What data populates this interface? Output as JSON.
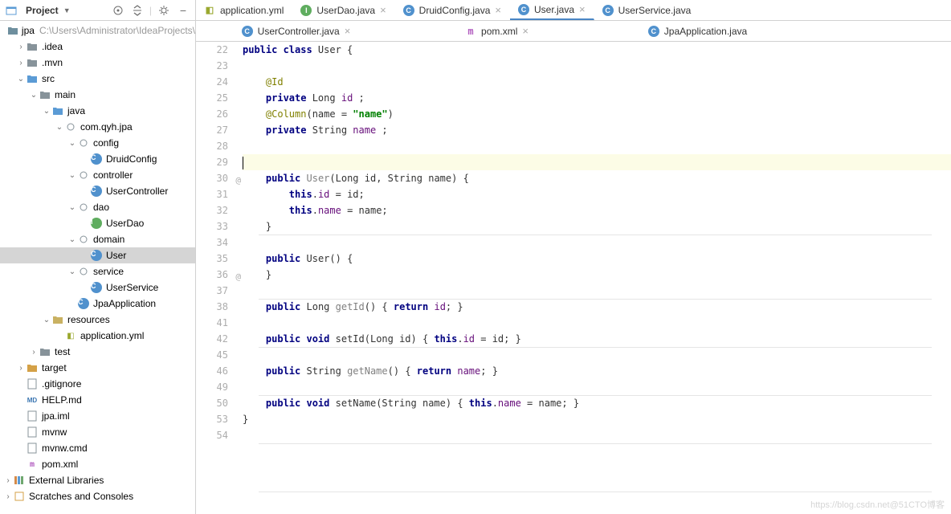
{
  "project": {
    "title": "Project",
    "root_name": "jpa",
    "root_path": "C:\\Users\\Administrator\\IdeaProjects\\",
    "tree": [
      {
        "indent": 0,
        "caret": "",
        "iconType": "module",
        "label": "jpa",
        "suffix": "C:\\Users\\Administrator\\IdeaProjects\\"
      },
      {
        "indent": 1,
        "caret": ">",
        "iconType": "folder",
        "label": ".idea"
      },
      {
        "indent": 1,
        "caret": ">",
        "iconType": "folder",
        "label": ".mvn"
      },
      {
        "indent": 1,
        "caret": "v",
        "iconType": "folder-src",
        "label": "src"
      },
      {
        "indent": 2,
        "caret": "v",
        "iconType": "folder",
        "label": "main"
      },
      {
        "indent": 3,
        "caret": "v",
        "iconType": "folder-src",
        "label": "java"
      },
      {
        "indent": 4,
        "caret": "v",
        "iconType": "pkg",
        "label": "com.qyh.jpa"
      },
      {
        "indent": 5,
        "caret": "v",
        "iconType": "pkg",
        "label": "config"
      },
      {
        "indent": 6,
        "caret": "",
        "iconType": "class",
        "label": "DruidConfig"
      },
      {
        "indent": 5,
        "caret": "v",
        "iconType": "pkg",
        "label": "controller"
      },
      {
        "indent": 6,
        "caret": "",
        "iconType": "class",
        "label": "UserController"
      },
      {
        "indent": 5,
        "caret": "v",
        "iconType": "pkg",
        "label": "dao"
      },
      {
        "indent": 6,
        "caret": "",
        "iconType": "iface",
        "label": "UserDao"
      },
      {
        "indent": 5,
        "caret": "v",
        "iconType": "pkg",
        "label": "domain"
      },
      {
        "indent": 6,
        "caret": "",
        "iconType": "class",
        "label": "User",
        "selected": true
      },
      {
        "indent": 5,
        "caret": "v",
        "iconType": "pkg",
        "label": "service"
      },
      {
        "indent": 6,
        "caret": "",
        "iconType": "class",
        "label": "UserService"
      },
      {
        "indent": 5,
        "caret": "",
        "iconType": "class",
        "label": "JpaApplication"
      },
      {
        "indent": 3,
        "caret": "v",
        "iconType": "resources",
        "label": "resources"
      },
      {
        "indent": 4,
        "caret": "",
        "iconType": "yml",
        "label": "application.yml"
      },
      {
        "indent": 2,
        "caret": ">",
        "iconType": "folder",
        "label": "test"
      },
      {
        "indent": 1,
        "caret": ">",
        "iconType": "folder-target",
        "label": "target"
      },
      {
        "indent": 1,
        "caret": "",
        "iconType": "file",
        "label": ".gitignore"
      },
      {
        "indent": 1,
        "caret": "",
        "iconType": "md",
        "label": "HELP.md"
      },
      {
        "indent": 1,
        "caret": "",
        "iconType": "file",
        "label": "jpa.iml"
      },
      {
        "indent": 1,
        "caret": "",
        "iconType": "file",
        "label": "mvnw"
      },
      {
        "indent": 1,
        "caret": "",
        "iconType": "file",
        "label": "mvnw.cmd"
      },
      {
        "indent": 1,
        "caret": "",
        "iconType": "pom",
        "label": "pom.xml"
      },
      {
        "indent": 0,
        "caret": ">",
        "iconType": "lib",
        "label": "External Libraries"
      },
      {
        "indent": 0,
        "caret": ">",
        "iconType": "scratch",
        "label": "Scratches and Consoles"
      }
    ]
  },
  "tabs_row1": [
    {
      "icon": "y",
      "label": "application.yml",
      "active": false
    },
    {
      "icon": "i",
      "label": "UserDao.java",
      "active": false,
      "close": true
    },
    {
      "icon": "c",
      "label": "DruidConfig.java",
      "active": false,
      "close": true
    },
    {
      "icon": "c",
      "label": "User.java",
      "active": true,
      "close": true
    },
    {
      "icon": "c",
      "label": "UserService.java",
      "active": false
    }
  ],
  "tabs_row2": [
    {
      "icon": "c",
      "label": "UserController.java",
      "active": false,
      "close": true
    },
    {
      "icon": "m",
      "label": "pom.xml",
      "active": false,
      "close": true
    },
    {
      "icon": "c",
      "label": "JpaApplication.java",
      "active": false
    }
  ],
  "code": {
    "lines": [
      {
        "n": 22,
        "html": "<span class='kw'>public class</span> User {"
      },
      {
        "n": 23,
        "html": ""
      },
      {
        "n": 24,
        "html": "    <span class='an'>@Id</span>"
      },
      {
        "n": 25,
        "html": "    <span class='kw'>private</span> Long <span class='fld'>id</span> ;"
      },
      {
        "n": 26,
        "html": "    <span class='an'>@Column</span>(name = <span class='str'>\"name\"</span>)"
      },
      {
        "n": 27,
        "html": "    <span class='kw'>private</span> String <span class='fld'>name</span> ;"
      },
      {
        "n": 28,
        "html": ""
      },
      {
        "n": 29,
        "html": "<span class='caret'></span>",
        "current": true
      },
      {
        "n": 30,
        "html": "    <span class='kw'>public</span> <span class='dim'>User</span>(Long id, String name) {",
        "mark": "@"
      },
      {
        "n": 31,
        "html": "        <span class='kw'>this</span>.<span class='fld'>id</span> = id;"
      },
      {
        "n": 32,
        "html": "        <span class='kw'>this</span>.<span class='fld'>name</span> = name;"
      },
      {
        "n": 33,
        "html": "    }"
      },
      {
        "n": 34,
        "html": "",
        "sep": true
      },
      {
        "n": 35,
        "html": "    <span class='kw'>public</span> User() {",
        "mark": "@"
      },
      {
        "n": 36,
        "html": "    }"
      },
      {
        "n": 37,
        "html": "",
        "sep": true
      },
      {
        "n": 38,
        "html": "    <span class='kw'>public</span> Long <span class='dim'>getId</span>() { <span class='kw'>return</span> <span class='fld'>id</span>; }"
      },
      {
        "n": 41,
        "html": "",
        "sep": true
      },
      {
        "n": 42,
        "html": "    <span class='kw'>public void</span> setId(Long id) { <span class='kw'>this</span>.<span class='fld'>id</span> = id; }"
      },
      {
        "n": 45,
        "html": "",
        "sep": true
      },
      {
        "n": 46,
        "html": "    <span class='kw'>public</span> String <span class='dim'>getName</span>() { <span class='kw'>return</span> <span class='fld'>name</span>; }"
      },
      {
        "n": 49,
        "html": "",
        "sep": true
      },
      {
        "n": 50,
        "html": "    <span class='kw'>public void</span> setName(String name) { <span class='kw'>this</span>.<span class='fld'>name</span> = name; }"
      },
      {
        "n": 53,
        "html": "}",
        "sep": true
      },
      {
        "n": 54,
        "html": ""
      }
    ]
  },
  "watermark": "https://blog.csdn.net@51CTO博客"
}
